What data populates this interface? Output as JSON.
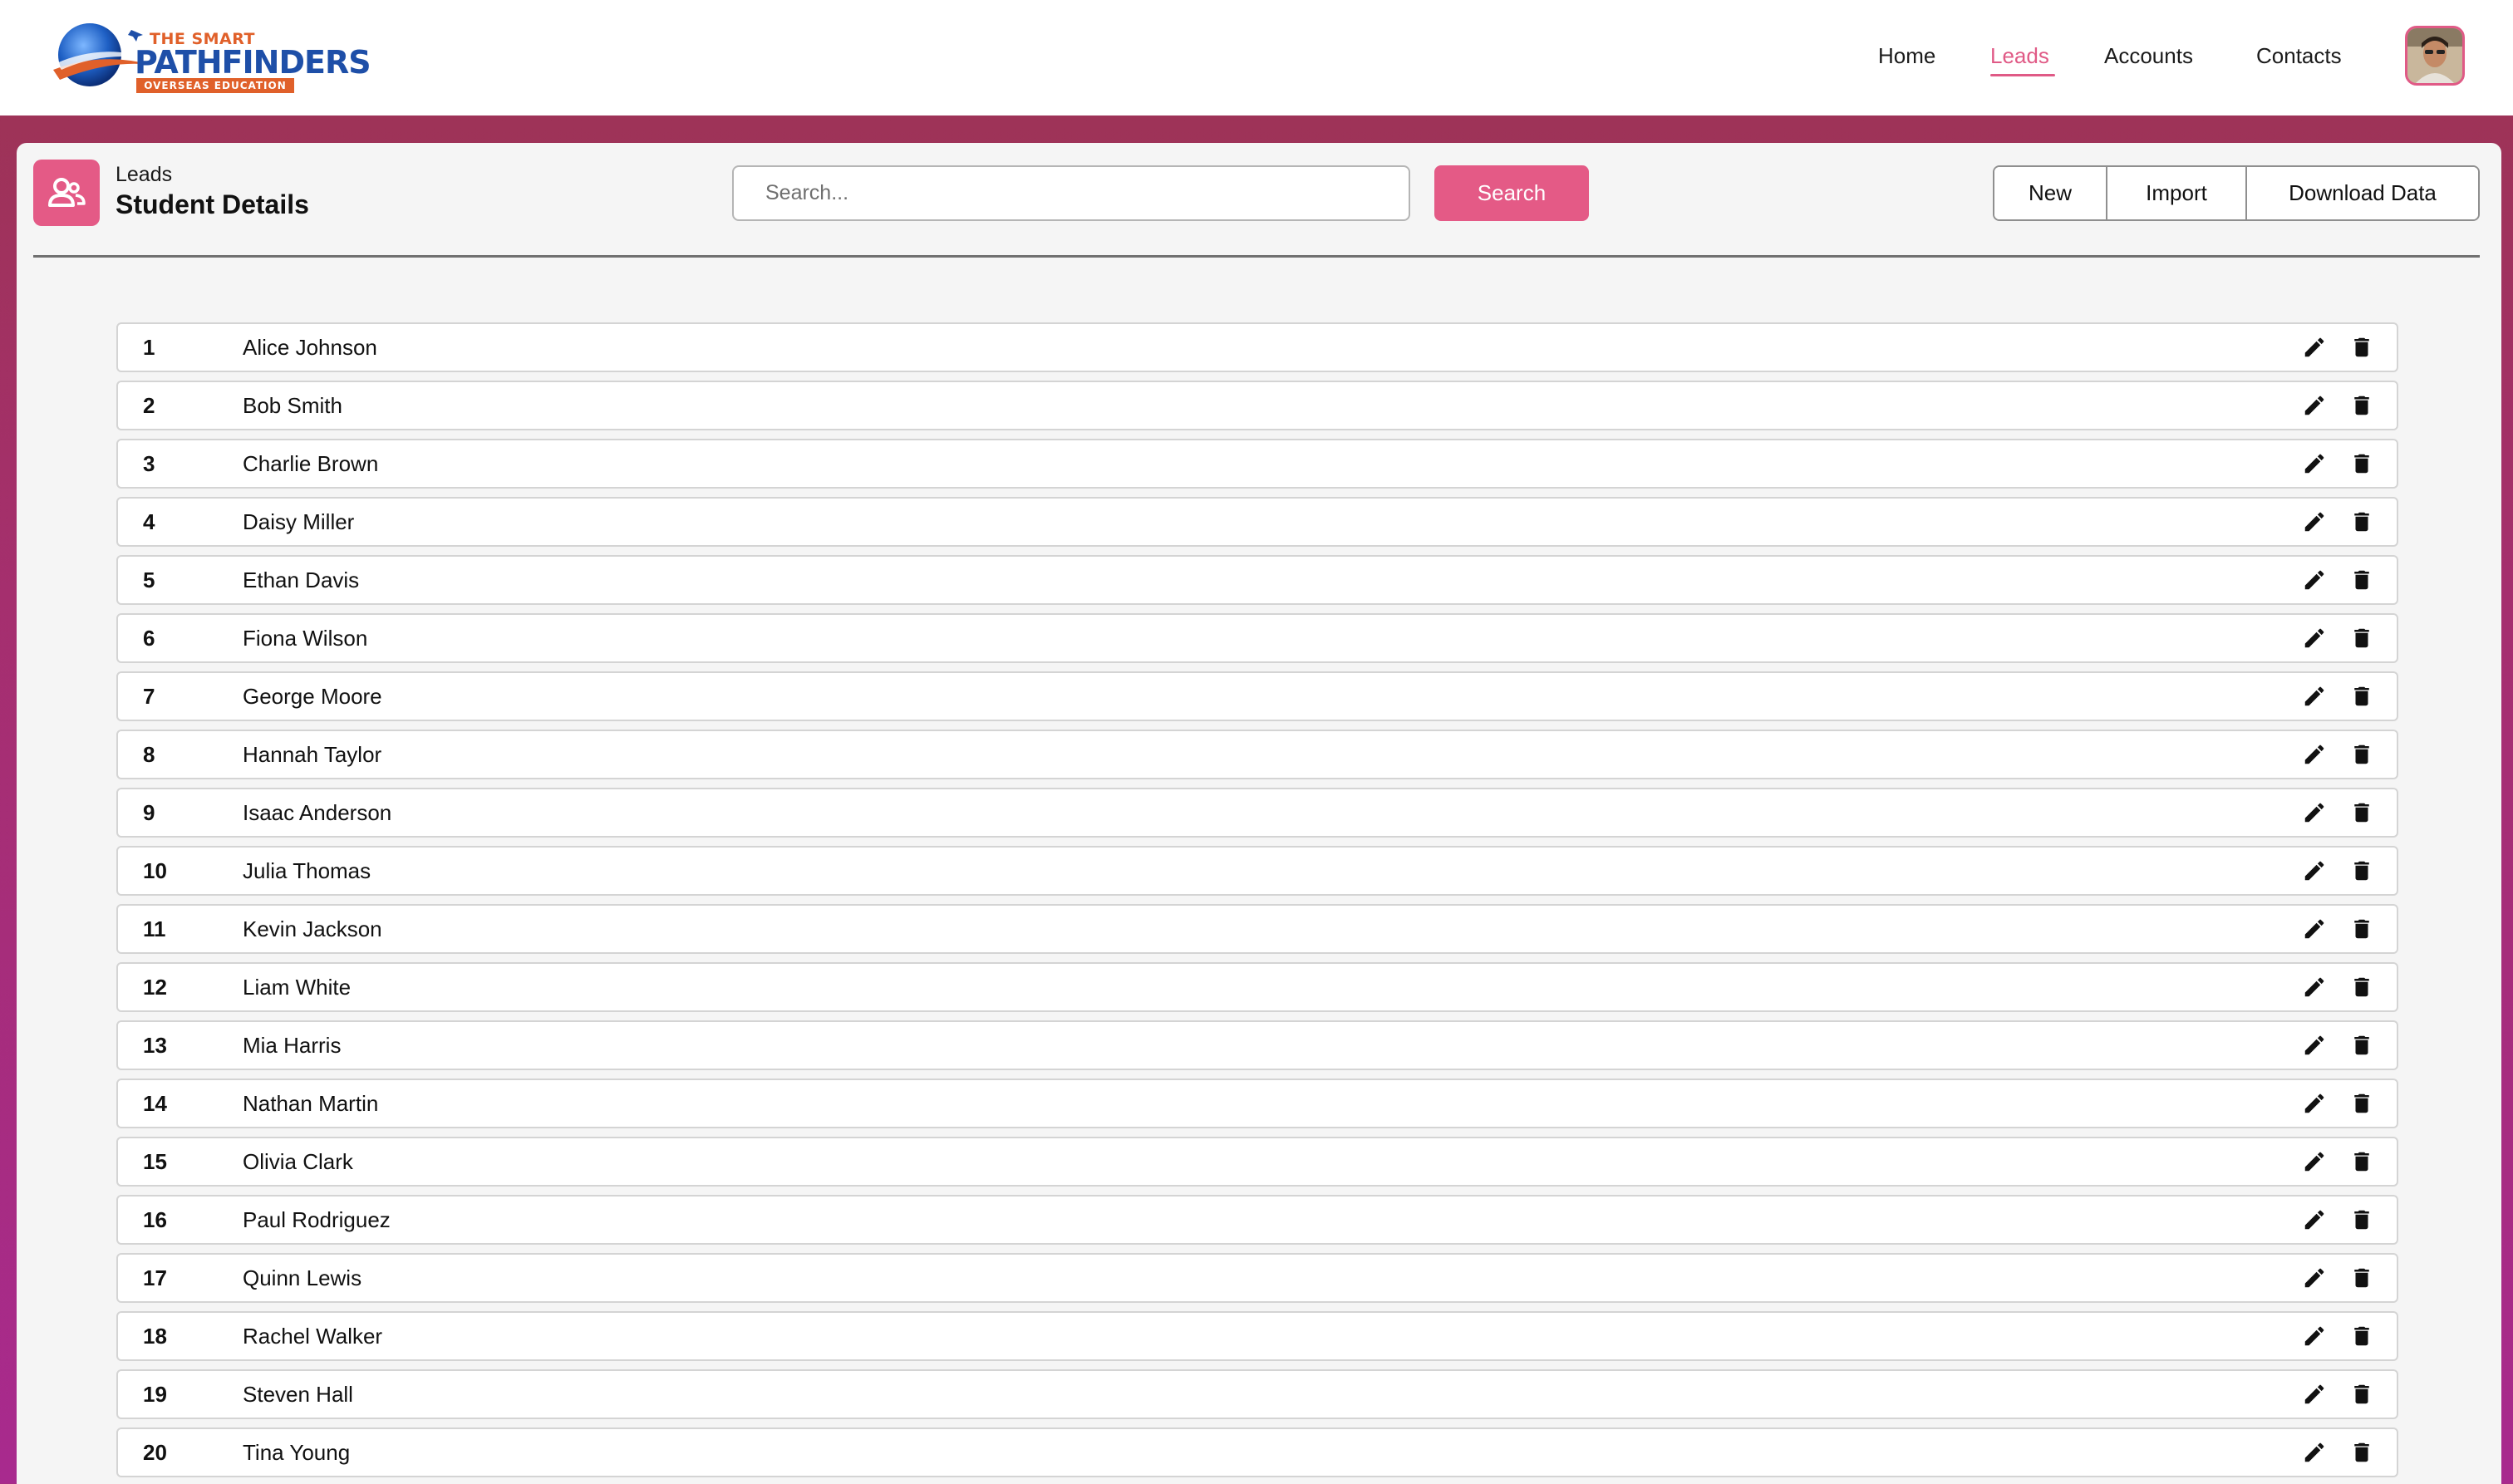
{
  "brand": {
    "logo_line1": "THE SMART",
    "logo_line2": "PATHFINDERS",
    "logo_line3": "OVERSEAS EDUCATION"
  },
  "nav": {
    "items": [
      {
        "label": "Home",
        "active": false
      },
      {
        "label": "Leads",
        "active": true
      },
      {
        "label": "Accounts",
        "active": false
      },
      {
        "label": "Contacts",
        "active": false
      }
    ],
    "accent_color": "#e05a86"
  },
  "header": {
    "breadcrumb": "Leads",
    "title": "Student Details",
    "icon": "user-group-icon"
  },
  "search": {
    "placeholder": "Search...",
    "value": "",
    "button_label": "Search"
  },
  "actions": {
    "new_label": "New",
    "import_label": "Import",
    "download_label": "Download Data"
  },
  "rows": [
    {
      "num": "1",
      "name": "Alice Johnson"
    },
    {
      "num": "2",
      "name": "Bob Smith"
    },
    {
      "num": "3",
      "name": "Charlie Brown"
    },
    {
      "num": "4",
      "name": "Daisy Miller"
    },
    {
      "num": "5",
      "name": "Ethan Davis"
    },
    {
      "num": "6",
      "name": "Fiona Wilson"
    },
    {
      "num": "7",
      "name": "George Moore"
    },
    {
      "num": "8",
      "name": "Hannah Taylor"
    },
    {
      "num": "9",
      "name": "Isaac Anderson"
    },
    {
      "num": "10",
      "name": "Julia Thomas"
    },
    {
      "num": "11",
      "name": "Kevin Jackson"
    },
    {
      "num": "12",
      "name": "Liam White"
    },
    {
      "num": "13",
      "name": "Mia Harris"
    },
    {
      "num": "14",
      "name": "Nathan Martin"
    },
    {
      "num": "15",
      "name": "Olivia Clark"
    },
    {
      "num": "16",
      "name": "Paul Rodriguez"
    },
    {
      "num": "17",
      "name": "Quinn Lewis"
    },
    {
      "num": "18",
      "name": "Rachel Walker"
    },
    {
      "num": "19",
      "name": "Steven Hall"
    },
    {
      "num": "20",
      "name": "Tina Young"
    }
  ],
  "row_icons": {
    "edit": "pencil-icon",
    "delete": "trash-icon"
  },
  "colors": {
    "accent": "#e45a86",
    "background_top": "#9c3452",
    "background_bottom": "#a82a8e"
  }
}
